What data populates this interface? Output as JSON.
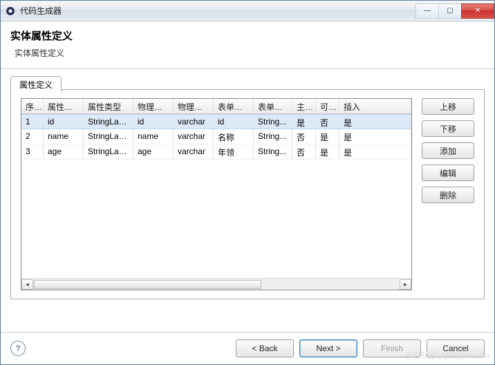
{
  "window": {
    "title": "代码生成器",
    "controls": {
      "min": "—",
      "max": "▢",
      "close": "✕"
    }
  },
  "header": {
    "title": "实体属性定义",
    "description": "实体属性定义"
  },
  "tab": {
    "label": "属性定义"
  },
  "table": {
    "columns": [
      "序号",
      "属性名称",
      "属性类型",
      "物理列名",
      "物理类型",
      "表单标签",
      "表单类型",
      "主键",
      "可空",
      "插入"
    ],
    "rows": [
      {
        "cells": [
          "1",
          "id",
          "StringLabel",
          "id",
          "varchar",
          "id",
          "String...",
          "是",
          "否",
          "是"
        ],
        "selected": true
      },
      {
        "cells": [
          "2",
          "name",
          "StringLabel",
          "name",
          "varchar",
          "名称",
          "String...",
          "否",
          "是",
          "是"
        ],
        "selected": false
      },
      {
        "cells": [
          "3",
          "age",
          "StringLabel",
          "age",
          "varchar",
          "年领",
          "String...",
          "否",
          "是",
          "是"
        ],
        "selected": false
      }
    ]
  },
  "sideButtons": {
    "moveUp": "上移",
    "moveDown": "下移",
    "add": "添加",
    "edit": "编辑",
    "delete": "删除"
  },
  "footer": {
    "help": "?",
    "back": "< Back",
    "next": "Next >",
    "finish": "Finish",
    "cancel": "Cancel"
  },
  "watermark": "云栖社区 yq.aliyun.com"
}
